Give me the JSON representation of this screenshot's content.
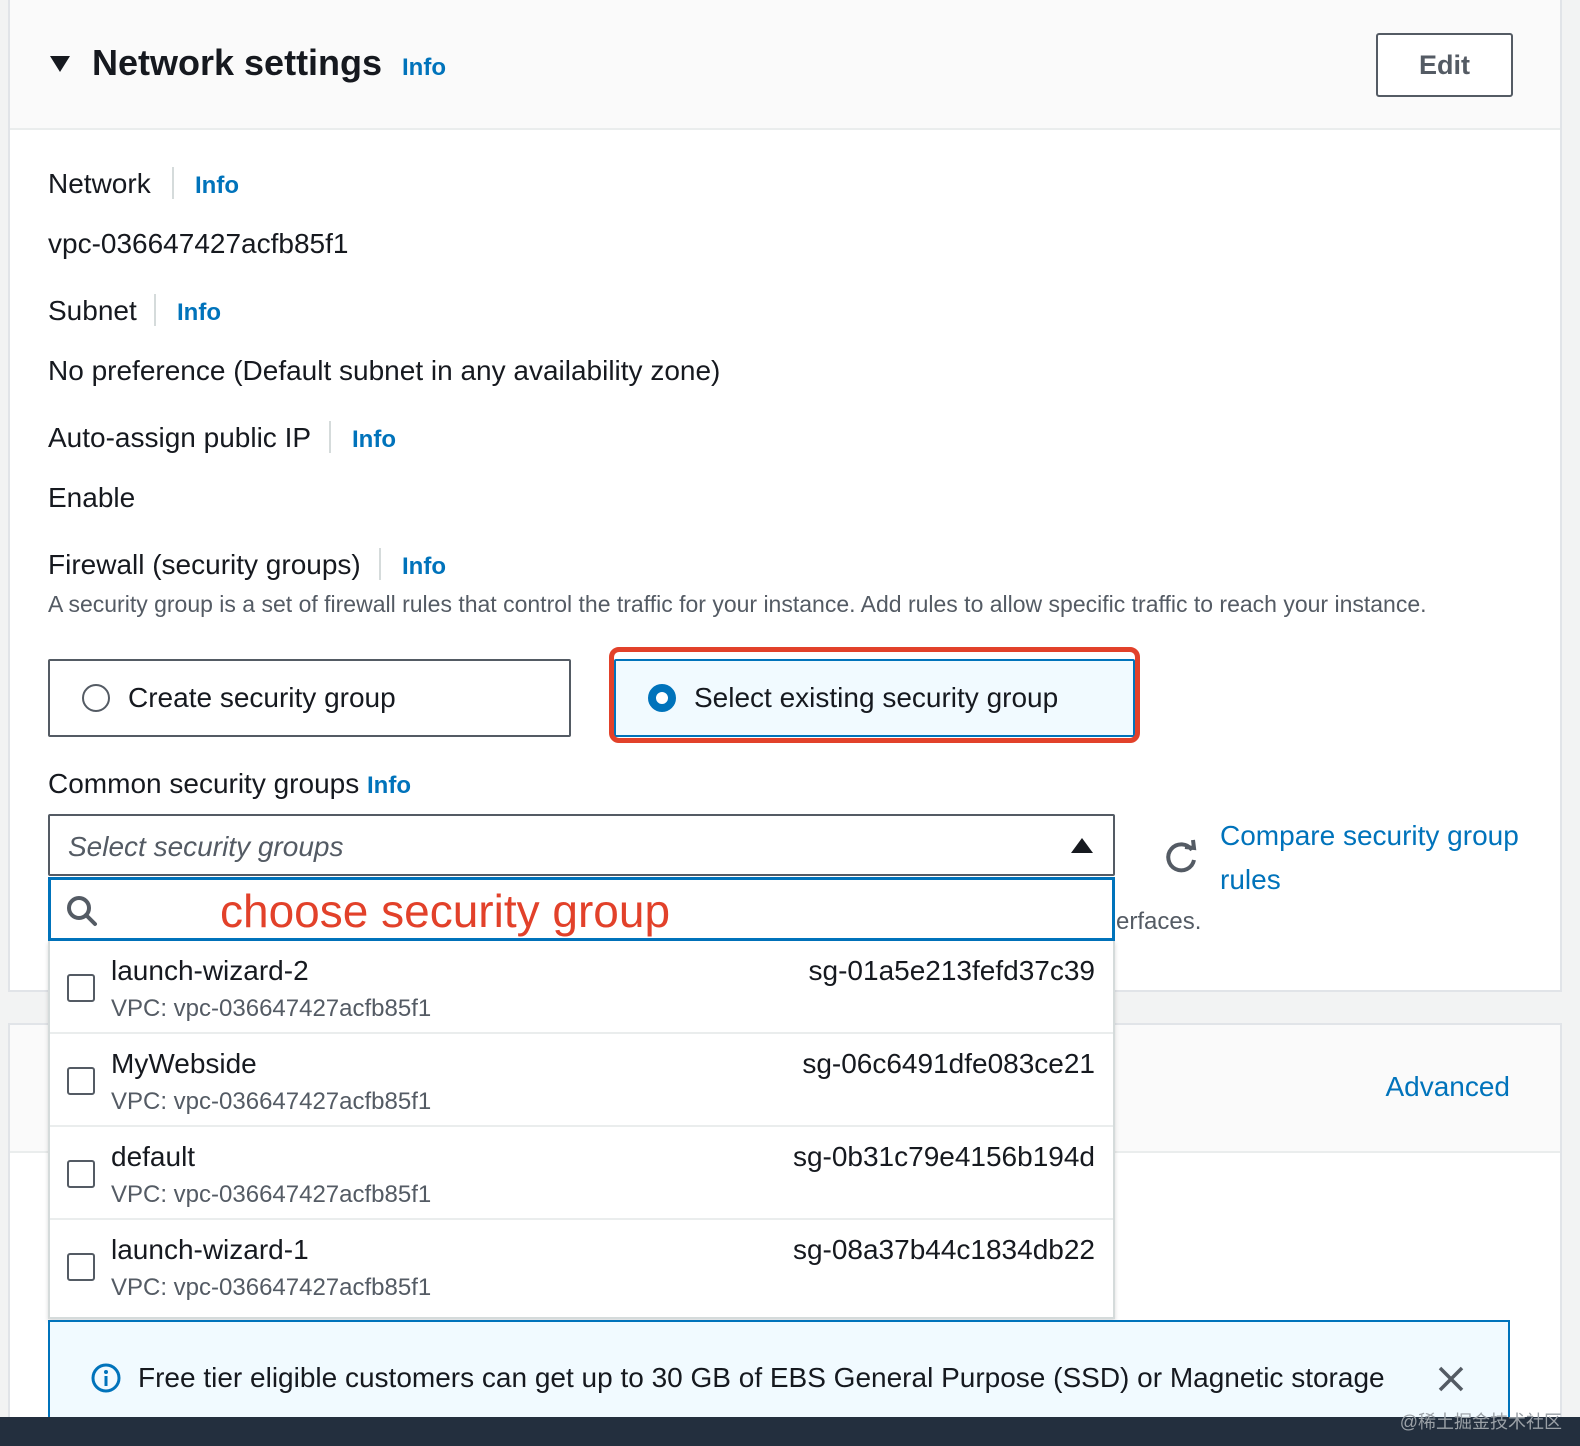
{
  "header": {
    "title": "Network settings",
    "info": "Info",
    "edit_label": "Edit"
  },
  "network": {
    "label": "Network",
    "info": "Info",
    "value": "vpc-036647427acfb85f1"
  },
  "subnet": {
    "label": "Subnet",
    "info": "Info",
    "value": "No preference (Default subnet in any availability zone)"
  },
  "auto_ip": {
    "label": "Auto-assign public IP",
    "info": "Info",
    "value": "Enable"
  },
  "firewall": {
    "label": "Firewall (security groups)",
    "info": "Info",
    "description": "A security group is a set of firewall rules that control the traffic for your instance. Add rules to allow specific traffic to reach your instance.",
    "options": [
      {
        "label": "Create security group",
        "selected": false
      },
      {
        "label": "Select existing security group",
        "selected": true
      }
    ]
  },
  "common_groups": {
    "label": "Common security groups",
    "info": "Info",
    "placeholder": "Select security groups",
    "compare_link": "Compare security group rules",
    "partial_text": "erfaces."
  },
  "annotation": "choose security group",
  "security_groups": [
    {
      "name": "launch-wizard-2",
      "vpc": "VPC: vpc-036647427acfb85f1",
      "id": "sg-01a5e213fefd37c39"
    },
    {
      "name": "MyWebside",
      "vpc": "VPC: vpc-036647427acfb85f1",
      "id": "sg-06c6491dfe083ce21"
    },
    {
      "name": "default",
      "vpc": "VPC: vpc-036647427acfb85f1",
      "id": "sg-0b31c79e4156b194d"
    },
    {
      "name": "launch-wizard-1",
      "vpc": "VPC: vpc-036647427acfb85f1",
      "id": "sg-08a37b44c1834db22"
    }
  ],
  "storage": {
    "advanced_label": "Advanced"
  },
  "alert": {
    "text": "Free tier eligible customers can get up to 30 GB of EBS General Purpose (SSD) or Magnetic storage"
  },
  "watermark": "@稀土掘金技术社区",
  "colors": {
    "link": "#0073bb",
    "highlight": "#e2412a",
    "selected_bg": "#f1faff"
  }
}
